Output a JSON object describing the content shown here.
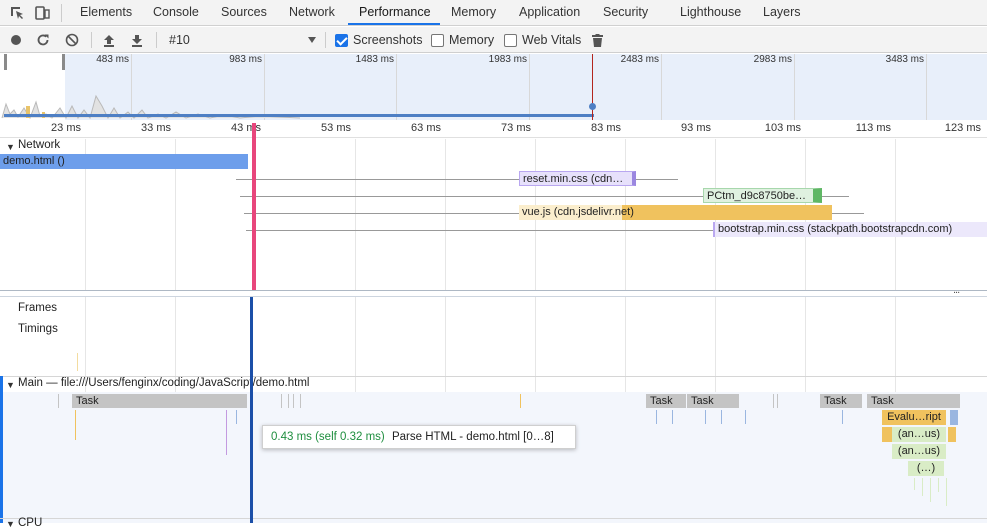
{
  "tabs": [
    {
      "label": "Elements"
    },
    {
      "label": "Console"
    },
    {
      "label": "Sources"
    },
    {
      "label": "Network"
    },
    {
      "label": "Performance",
      "active": true
    },
    {
      "label": "Memory"
    },
    {
      "label": "Application"
    },
    {
      "label": "Security"
    },
    {
      "label": "Lighthouse"
    },
    {
      "label": "Layers"
    }
  ],
  "controls": {
    "recording_select": "#10",
    "screenshots_label": "Screenshots",
    "screenshots_checked": true,
    "memory_label": "Memory",
    "memory_checked": false,
    "webvitals_label": "Web Vitals",
    "webvitals_checked": false
  },
  "overview": {
    "ticks": [
      "483 ms",
      "983 ms",
      "1483 ms",
      "1983 ms",
      "2483 ms",
      "2983 ms",
      "3483 ms"
    ]
  },
  "ruler": {
    "ticks": [
      "23 ms",
      "33 ms",
      "43 ms",
      "53 ms",
      "63 ms",
      "73 ms",
      "83 ms",
      "93 ms",
      "103 ms",
      "113 ms",
      "123 ms"
    ]
  },
  "network": {
    "header": "Network",
    "requests": [
      {
        "label": "demo.html ()"
      },
      {
        "label": "reset.min.css (cdn…"
      },
      {
        "label": "PCtm_d9c8750be…"
      },
      {
        "label": "vue.js (cdn.jsdelivr.net)"
      },
      {
        "label": "bootstrap.min.css (stackpath.bootstrapcdn.com)"
      }
    ]
  },
  "tracks": {
    "frames": "Frames",
    "timings": "Timings",
    "main": "Main — file:///Users/fenginx/coding/JavaScript/demo.html",
    "cpu": "CPU"
  },
  "tasks": [
    {
      "label": "Task"
    },
    {
      "label": "Task"
    },
    {
      "label": "Task"
    },
    {
      "label": "Task"
    },
    {
      "label": "Task"
    }
  ],
  "events": [
    {
      "label": "Evalu…ript"
    },
    {
      "label": "(an…us)"
    },
    {
      "label": "(an…us)"
    },
    {
      "label": "(…)"
    }
  ],
  "tooltip": {
    "time": "0.43 ms (self 0.32 ms)",
    "name": "Parse HTML - demo.html [0…8]"
  },
  "colors": {
    "accent": "#1a73e8",
    "network_html": "#6d9eeb",
    "network_css": "#b9a7f0",
    "network_js": "#f0c25e",
    "network_img": "#6fc07a",
    "playhead": "#e8467c",
    "task": "#c4c4c4",
    "script": "#f0c25e"
  }
}
